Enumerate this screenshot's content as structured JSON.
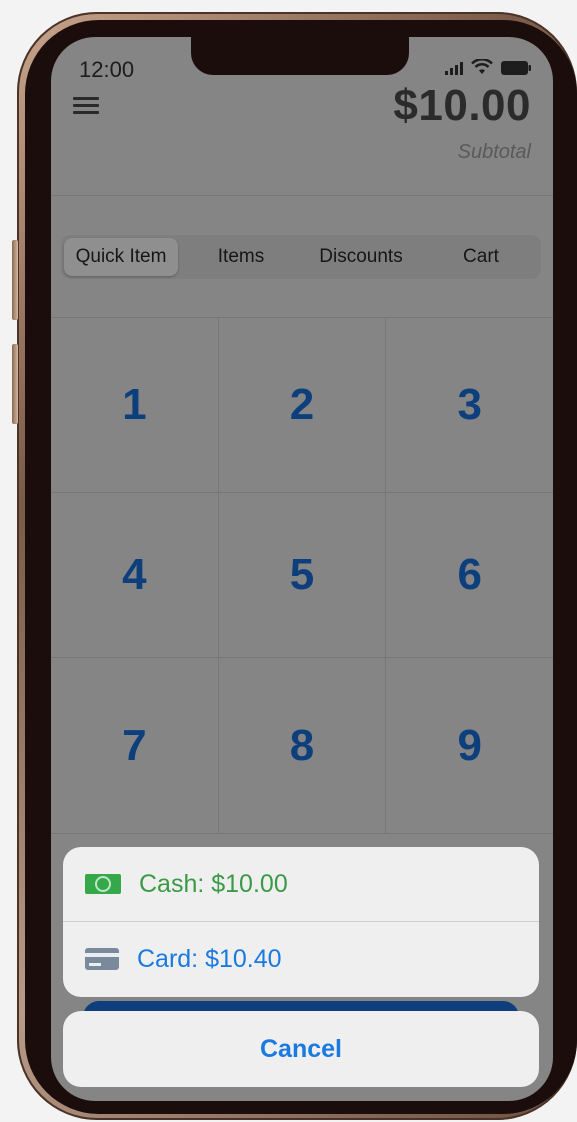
{
  "status": {
    "time": "12:00"
  },
  "header": {
    "total": "$10.00",
    "subtotal_label": "Subtotal"
  },
  "tabs": [
    {
      "label": "Quick Item",
      "active": true
    },
    {
      "label": "Items",
      "active": false
    },
    {
      "label": "Discounts",
      "active": false
    },
    {
      "label": "Cart",
      "active": false
    }
  ],
  "keypad": [
    [
      "1",
      "2",
      "3"
    ],
    [
      "4",
      "5",
      "6"
    ],
    [
      "7",
      "8",
      "9"
    ]
  ],
  "payment_sheet": {
    "cash_label": "Cash: $10.00",
    "card_label": "Card: $10.40",
    "cancel_label": "Cancel"
  },
  "colors": {
    "keypad_digit": "#0d3f7d",
    "cash_green": "#3a9a46",
    "link_blue": "#1a7ae0"
  },
  "icons": [
    "menu-icon",
    "signal-icon",
    "wifi-icon",
    "battery-icon",
    "cash-icon",
    "credit-card-icon"
  ]
}
